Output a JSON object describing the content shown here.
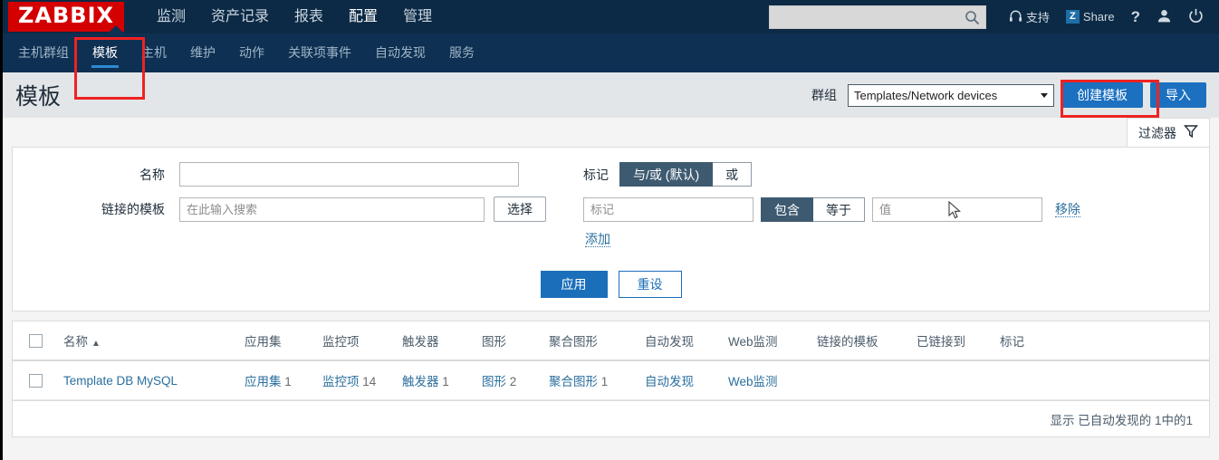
{
  "brand": {
    "logo": "ZABBIX",
    "logo_bg": "#d40000"
  },
  "topnav": {
    "items": [
      {
        "label": "监测",
        "active": false
      },
      {
        "label": "资产记录",
        "active": false
      },
      {
        "label": "报表",
        "active": false
      },
      {
        "label": "配置",
        "active": true
      },
      {
        "label": "管理",
        "active": false
      }
    ],
    "search": {
      "value": "",
      "placeholder": ""
    },
    "support_label": "支持",
    "share_badge": "Z",
    "share_label": "Share",
    "help_label": "?",
    "icons": [
      "headset-icon",
      "share-icon",
      "help-icon",
      "user-icon",
      "power-icon"
    ]
  },
  "subnav": {
    "items": [
      {
        "label": "主机群组",
        "active": false
      },
      {
        "label": "模板",
        "active": true
      },
      {
        "label": "主机",
        "active": false
      },
      {
        "label": "维护",
        "active": false
      },
      {
        "label": "动作",
        "active": false
      },
      {
        "label": "关联项事件",
        "active": false
      },
      {
        "label": "自动发现",
        "active": false
      },
      {
        "label": "服务",
        "active": false
      }
    ]
  },
  "page": {
    "title": "模板",
    "group_label": "群组",
    "group_value": "Templates/Network devices",
    "create_button": "创建模板",
    "import_button": "导入",
    "filter_tab": "过滤器"
  },
  "filter": {
    "name_label": "名称",
    "name_value": "",
    "name_placeholder": "",
    "linked_templates_label": "链接的模板",
    "linked_templates_value": "",
    "linked_templates_placeholder": "在此输入搜索",
    "select_button": "选择",
    "tags_label": "标记",
    "evaltype": {
      "options": [
        "与/或 (默认)",
        "或"
      ],
      "selected": "与/或 (默认)"
    },
    "tag_value": "",
    "tag_placeholder": "标记",
    "operator": {
      "options": [
        "包含",
        "等于"
      ],
      "selected": "包含"
    },
    "value_value": "",
    "value_placeholder": "值",
    "remove_link": "移除",
    "add_link": "添加",
    "apply_button": "应用",
    "reset_button": "重设"
  },
  "table": {
    "columns": [
      "名称",
      "应用集",
      "监控项",
      "触发器",
      "图形",
      "聚合图形",
      "自动发现",
      "Web监测",
      "链接的模板",
      "已链接到",
      "标记"
    ],
    "sort_column": "名称",
    "sort_dir_icon": "▲",
    "rows": [
      {
        "selected": false,
        "name": "Template DB MySQL",
        "applications": {
          "label": "应用集",
          "count": "1"
        },
        "items": {
          "label": "监控项",
          "count": "14"
        },
        "triggers": {
          "label": "触发器",
          "count": "1"
        },
        "graphs": {
          "label": "图形",
          "count": "2"
        },
        "dashboards": {
          "label": "聚合图形",
          "count": "1"
        },
        "discovery": {
          "label": "自动发现",
          "count": ""
        },
        "web": {
          "label": "Web监测",
          "count": ""
        },
        "linked_templates": "",
        "linked_to": "",
        "tags": ""
      }
    ],
    "footer": "显示 已自动发现的 1中的1"
  },
  "annotations": {
    "highlight_color": "#ee2222",
    "boxes": [
      "subnav-templates-tab",
      "create-template-button"
    ]
  }
}
